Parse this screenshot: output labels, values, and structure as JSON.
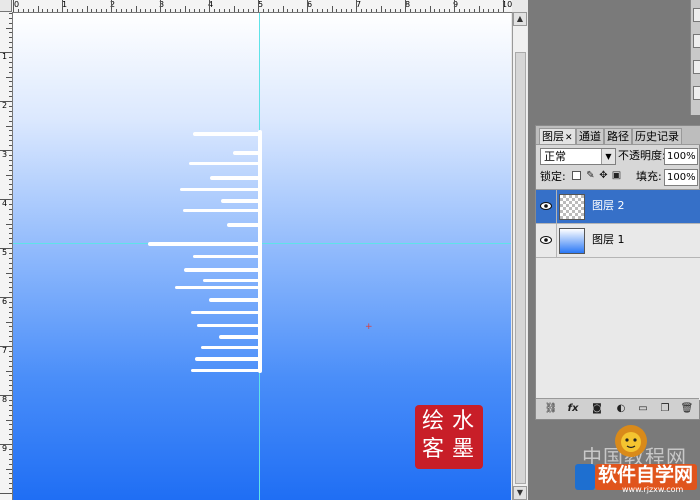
{
  "rulers": {
    "top_labels": [
      "0",
      "1",
      "2",
      "3",
      "4",
      "5",
      "6",
      "7",
      "8",
      "9",
      "10"
    ],
    "left_labels": [
      "1",
      "2",
      "3",
      "4",
      "5",
      "6",
      "7",
      "8",
      "9"
    ]
  },
  "canvas": {
    "seal_chars": [
      "水",
      "墨",
      "绘",
      "客"
    ]
  },
  "layers_panel": {
    "tabs": [
      {
        "label": "图层",
        "active": true
      },
      {
        "label": "通道",
        "active": false
      },
      {
        "label": "路径",
        "active": false
      },
      {
        "label": "历史记录",
        "active": false
      }
    ],
    "blend_mode": "正常",
    "opacity_label": "不透明度:",
    "opacity_value": "100%",
    "lock_label": "锁定:",
    "fill_label": "填充:",
    "fill_value": "100%",
    "layers": [
      {
        "name": "图层 2",
        "selected": true,
        "thumb": "transparent"
      },
      {
        "name": "图层 1",
        "selected": false,
        "thumb": "gradient"
      }
    ],
    "footer_icons": [
      "link-icon",
      "fx-icon",
      "mask-icon",
      "adjustment-icon",
      "group-icon",
      "new-layer-icon",
      "trash-icon"
    ]
  },
  "watermark": {
    "site_cn": "中国教程网",
    "brand": "软件自学网",
    "url": "www.rjzxw.com"
  },
  "colors": {
    "selection": "#3670c8",
    "guide": "#5fe3e8",
    "seal": "#c81e28"
  }
}
